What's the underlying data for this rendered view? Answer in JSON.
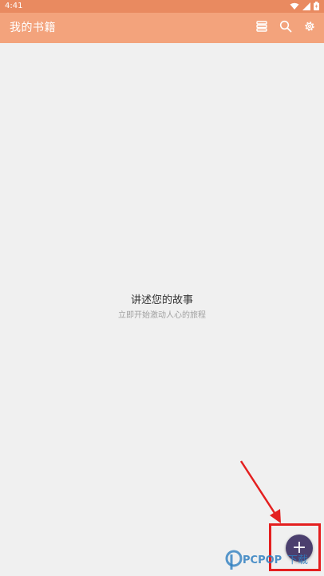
{
  "status_bar": {
    "time": "4:41",
    "icons": [
      "wifi-icon",
      "signal-icon",
      "battery-icon"
    ]
  },
  "app_bar": {
    "title": "我的书籍",
    "actions": [
      "list-view-icon",
      "search-icon",
      "settings-icon"
    ]
  },
  "empty_state": {
    "title": "讲述您的故事",
    "subtitle": "立即开始激动人心的旅程"
  },
  "fab": {
    "icon": "plus-icon",
    "label": "+"
  },
  "watermark": {
    "text": "PCPOP下载"
  },
  "colors": {
    "status_bar": "#e98a60",
    "app_bar": "#f3a37c",
    "background": "#f0f0f0",
    "fab": "#4b3f6e",
    "annotation": "#e41f1f"
  }
}
